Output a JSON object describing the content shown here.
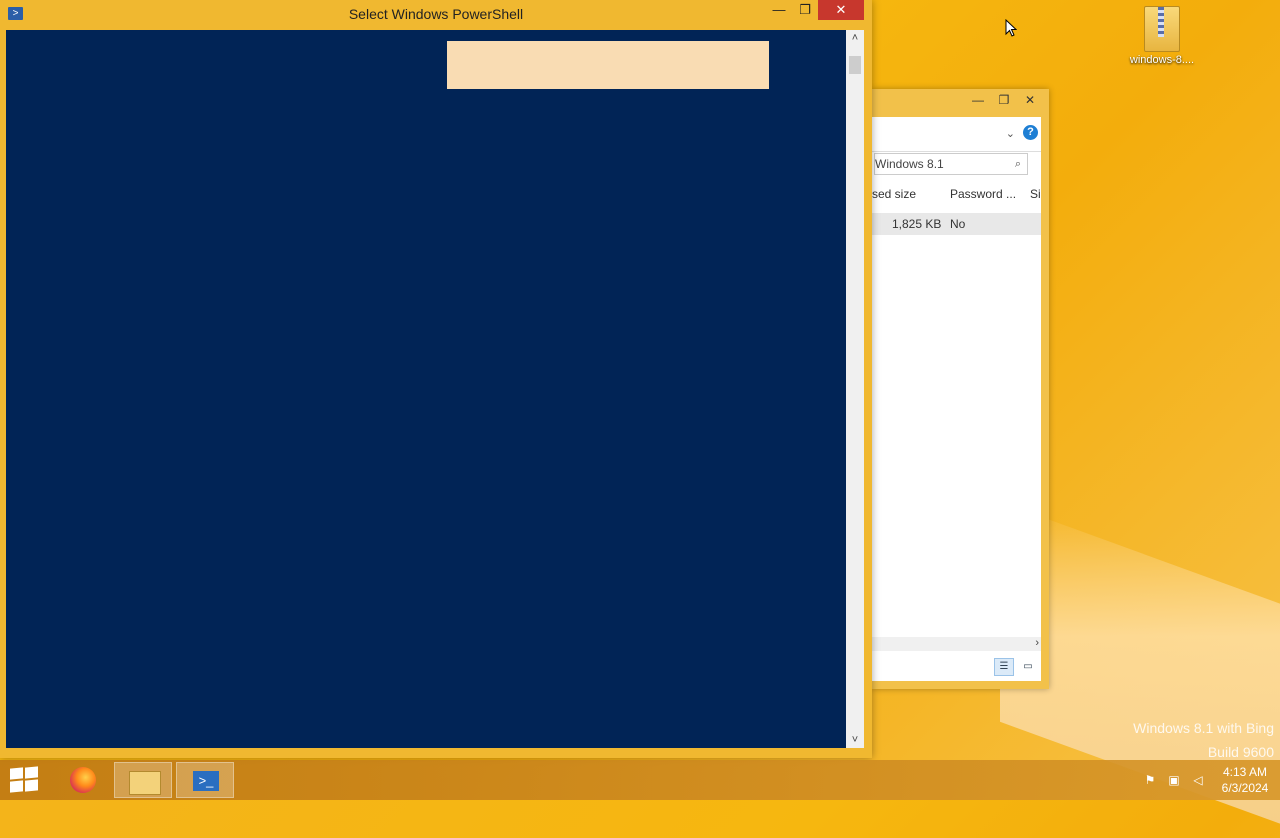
{
  "desktop": {
    "icon_label": "windows-8....",
    "icon_name": "zip-folder-icon",
    "watermark_line1": "Windows 8.1 with Bing",
    "watermark_line2": "Build 9600"
  },
  "powershell": {
    "title": "Select Windows PowerShell",
    "minimize": "—",
    "maximize": "❐",
    "close": "✕",
    "console_bg": "#012456",
    "selection_color": "#f9dcb3",
    "scroll_up": "˄",
    "scroll_down": "˅"
  },
  "explorer": {
    "minimize": "—",
    "maximize": "❐",
    "close": "✕",
    "help": "?",
    "search_text": "Windows 8.1",
    "columns": [
      "sed size",
      "Password ...",
      "Si"
    ],
    "rows": [
      {
        "size": "1,825 KB",
        "password": "No"
      }
    ],
    "scroll_right": "›"
  },
  "taskbar": {
    "apps": [
      {
        "name": "Firefox",
        "icon": "firefox-icon"
      },
      {
        "name": "File Explorer",
        "icon": "file-explorer-icon"
      },
      {
        "name": "Windows PowerShell",
        "icon": "powershell-icon",
        "active": true
      }
    ],
    "time": "4:13 AM",
    "date": "6/3/2024"
  },
  "colors": {
    "accent": "#f0b830",
    "close_red": "#c7372d"
  }
}
